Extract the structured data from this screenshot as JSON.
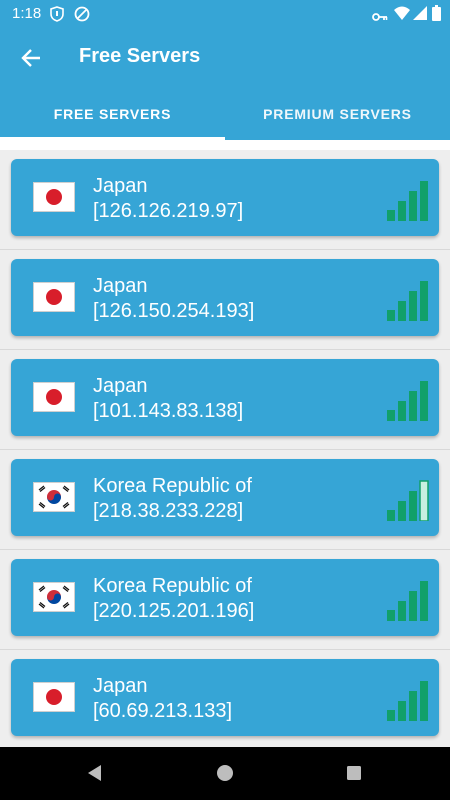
{
  "status_bar": {
    "time": "1:18"
  },
  "app_bar": {
    "title": "Free Servers"
  },
  "tabs": [
    {
      "label": "FREE SERVERS",
      "selected": true
    },
    {
      "label": "PREMIUM SERVERS",
      "selected": false
    }
  ],
  "servers": [
    {
      "country": "Japan",
      "ip": "[126.126.219.97]",
      "flag": "japan-flag-icon",
      "signal_bars": 4
    },
    {
      "country": "Japan",
      "ip": "[126.150.254.193]",
      "flag": "japan-flag-icon",
      "signal_bars": 4
    },
    {
      "country": "Japan",
      "ip": "[101.143.83.138]",
      "flag": "japan-flag-icon",
      "signal_bars": 4
    },
    {
      "country": "Korea Republic of",
      "ip": "[218.38.233.228]",
      "flag": "korea-flag-icon",
      "signal_bars": 3
    },
    {
      "country": "Korea Republic of",
      "ip": "[220.125.201.196]",
      "flag": "korea-flag-icon",
      "signal_bars": 4
    },
    {
      "country": "Japan",
      "ip": "[60.69.213.133]",
      "flag": "japan-flag-icon",
      "signal_bars": 4
    }
  ],
  "colors": {
    "primary": "#36a5d6",
    "signal": "#11a06a",
    "signal_off": "#c8f0e0"
  }
}
